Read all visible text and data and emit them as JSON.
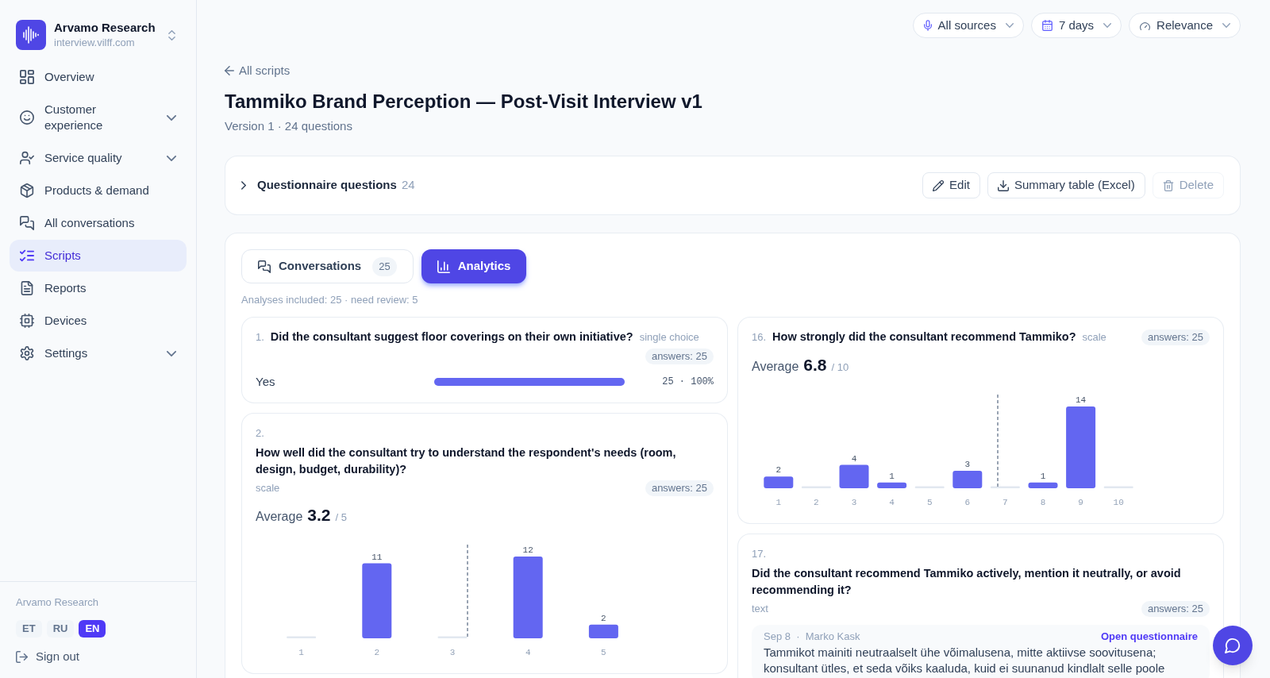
{
  "sidebar": {
    "workspace": {
      "name": "Arvamo Research",
      "domain": "interview.vilff.com"
    },
    "nav": [
      {
        "label": "Overview",
        "kind": "link",
        "selected": false
      },
      {
        "label": "Customer experience",
        "kind": "group",
        "selected": false
      },
      {
        "label": "Service quality",
        "kind": "group",
        "selected": false
      },
      {
        "label": "Products & demand",
        "kind": "link",
        "selected": false
      },
      {
        "label": "All conversations",
        "kind": "link",
        "selected": false
      },
      {
        "label": "Scripts",
        "kind": "link",
        "selected": true
      },
      {
        "label": "Reports",
        "kind": "link",
        "selected": false
      },
      {
        "label": "Devices",
        "kind": "link",
        "selected": false
      },
      {
        "label": "Settings",
        "kind": "group",
        "selected": false
      }
    ],
    "footer": {
      "workspace": "Arvamo Research",
      "languages": [
        {
          "label": "ET",
          "selected": false
        },
        {
          "label": "RU",
          "selected": false
        },
        {
          "label": "EN",
          "selected": true
        }
      ],
      "sign_out": "Sign out"
    }
  },
  "filters": [
    {
      "label": "All sources"
    },
    {
      "label": "7 days"
    },
    {
      "label": "Relevance"
    }
  ],
  "header": {
    "back_link": "All scripts",
    "title": "Tammiko Brand Perception — Post-Visit Interview v1",
    "subtitle": "Version 1 · 24 questions"
  },
  "questionnaire": {
    "label": "Questionnaire questions",
    "count": "24",
    "expanded": false,
    "actions": [
      {
        "label": "Edit",
        "disabled": false
      },
      {
        "label": "Summary table (Excel)",
        "disabled": false
      },
      {
        "label": "Delete",
        "disabled": true
      }
    ]
  },
  "tabs": [
    {
      "label": "Conversations",
      "count": "25",
      "selected": false
    },
    {
      "label": "Analytics",
      "selected": true
    }
  ],
  "analytics": {
    "summary": "Analyses included: 25 · need review: 5",
    "columns": [
      {
        "questions": [
          {
            "number": "1.",
            "text": "Did the consultant suggest floor coverings on their own initiative?",
            "type": "single choice",
            "answers": "answers: 25",
            "kind": "choice",
            "options": [
              {
                "label": "Yes",
                "level": 1,
                "reading": "25 · 100%"
              }
            ]
          },
          {
            "number": "2.",
            "text": "How well did the consultant try to understand the respondent's needs (room, design, budget, durability)?",
            "type": "scale",
            "answers": "answers: 25",
            "kind": "scale",
            "average_label": "Average",
            "average": "3.2",
            "scale_max": "/ 5",
            "chart_data": {
              "type": "bar",
              "categories": [
                "1",
                "2",
                "3",
                "4",
                "5"
              ],
              "values": [
                0,
                11,
                0,
                12,
                2
              ],
              "value_labels": [
                null,
                "11",
                null,
                "12",
                "2"
              ]
            }
          }
        ]
      },
      {
        "questions": [
          {
            "number": "16.",
            "text": "How strongly did the consultant recommend Tammiko?",
            "type": "scale",
            "answers": "answers: 25",
            "kind": "scale",
            "average_label": "Average",
            "average": "6.8",
            "scale_max": "/ 10",
            "chart_data": {
              "type": "bar",
              "categories": [
                "1",
                "2",
                "3",
                "4",
                "5",
                "6",
                "7",
                "8",
                "9",
                "10"
              ],
              "values": [
                2,
                0,
                4,
                1,
                0,
                3,
                0,
                1,
                14,
                0
              ],
              "value_labels": [
                "2",
                null,
                "4",
                "1",
                null,
                "3",
                null,
                "1",
                "14",
                null
              ]
            }
          },
          {
            "number": "17.",
            "text": "Did the consultant recommend Tammiko actively, mention it neutrally, or avoid recommending it?",
            "type": "text",
            "answers": "answers: 25",
            "kind": "text",
            "responses": [
              {
                "meta": "Sep 8  ·  Marko Kask",
                "link": "Open questionnaire",
                "text": "Tammikot mainiti neutraalselt ühe võimalusena, mitte aktiivse soovitusena; konsultant ütles, et seda võiks kaaluda, kuid ei suunanud kindlalt selle poole"
              }
            ]
          }
        ]
      }
    ]
  }
}
